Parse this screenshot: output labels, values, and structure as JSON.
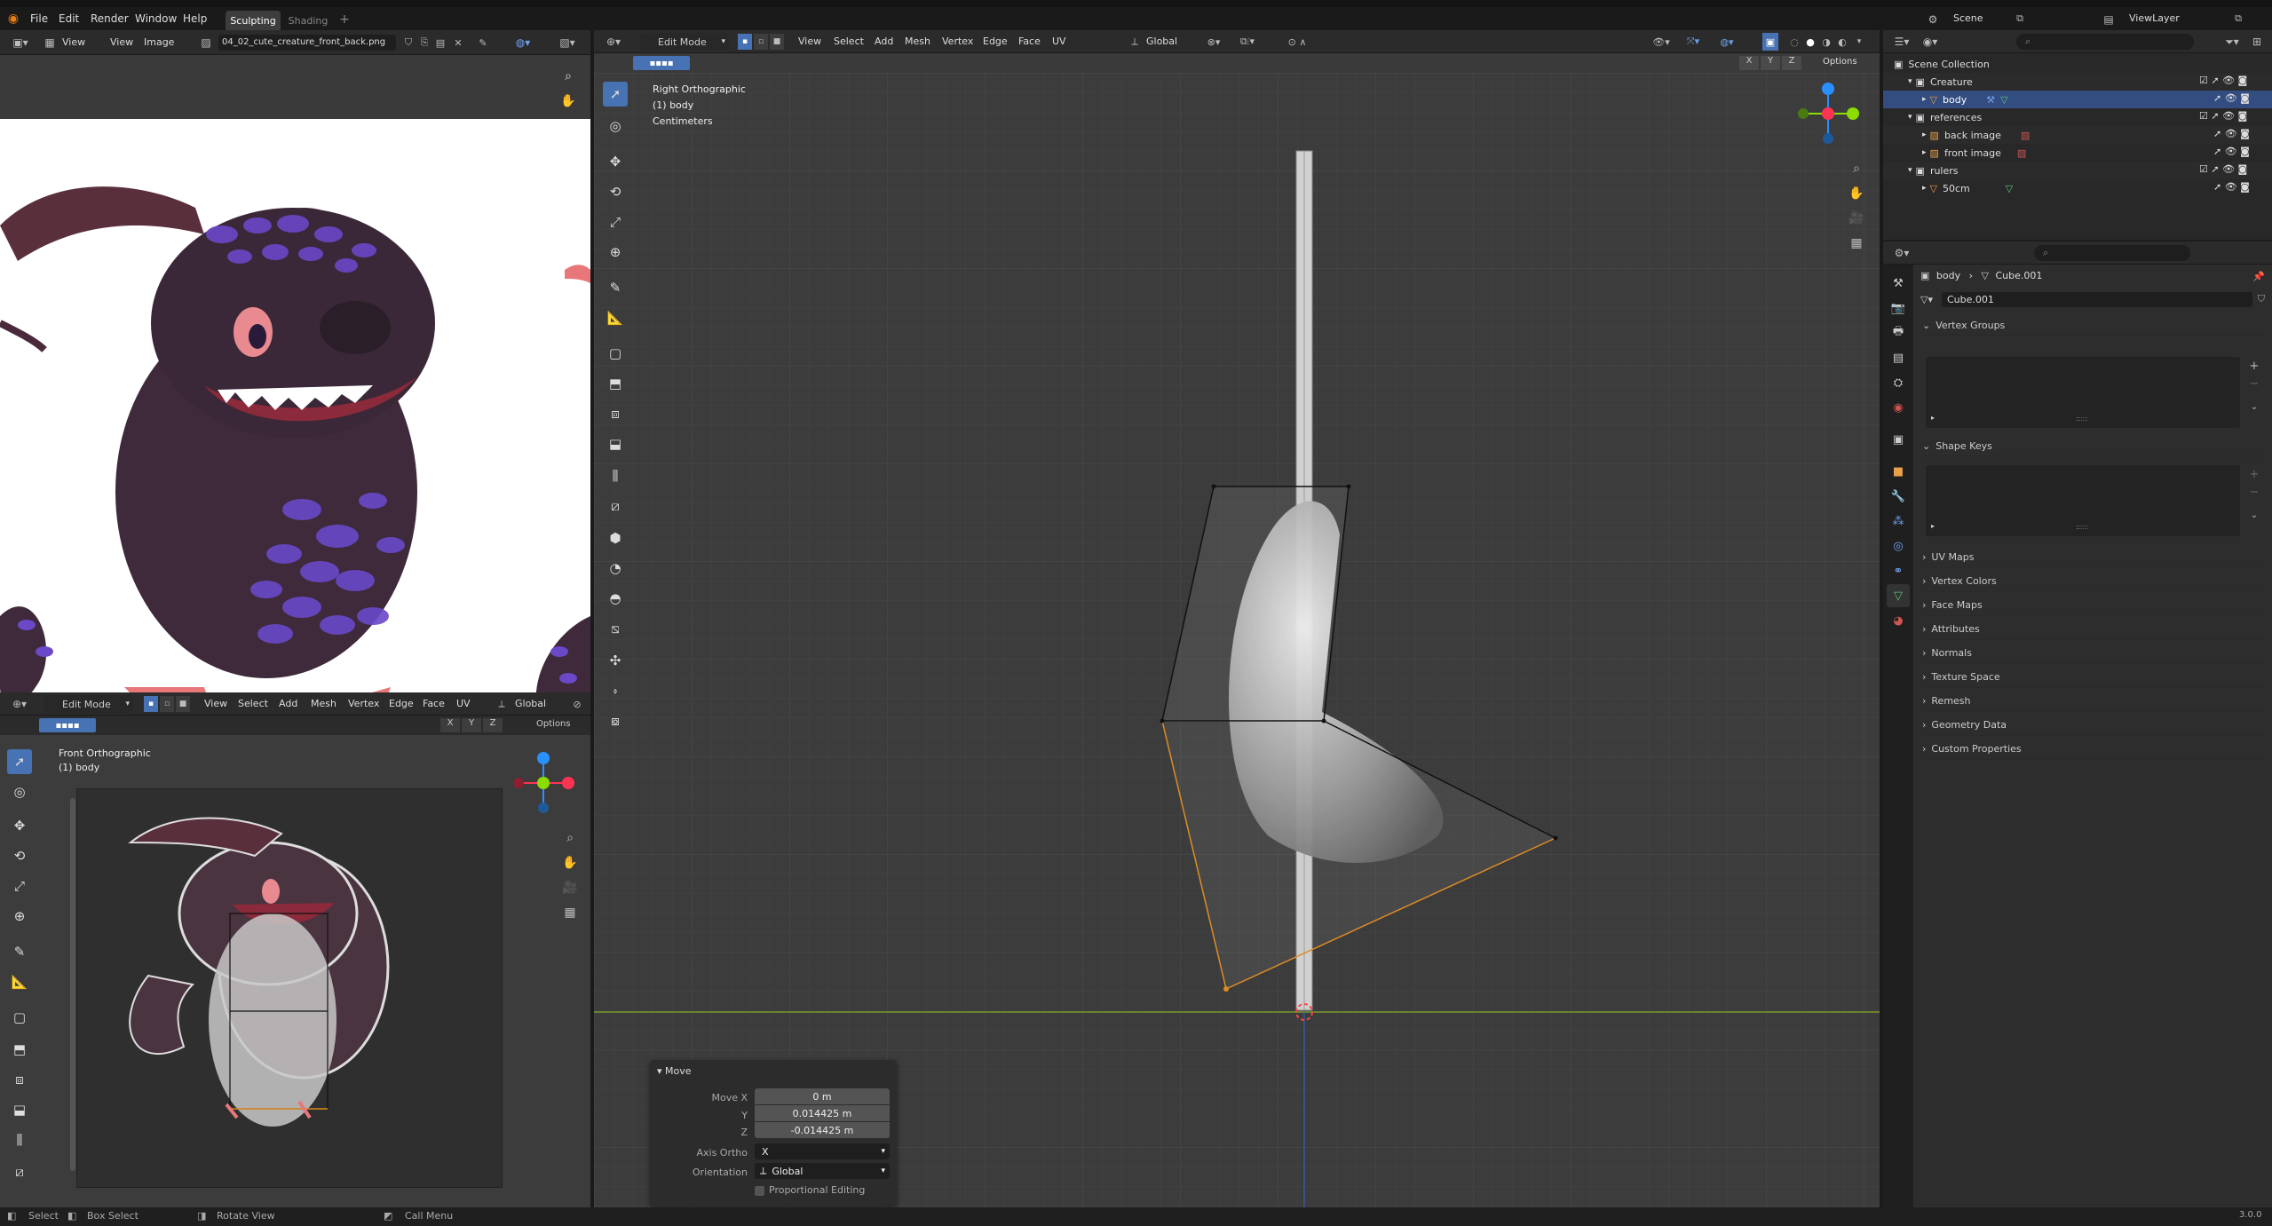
{
  "topbar": {
    "menus": [
      "File",
      "Edit",
      "Render",
      "Window",
      "Help"
    ],
    "workspaces": [
      "Sculpting",
      "Shading"
    ],
    "add_tab": "+",
    "scene_name": "Scene",
    "view_layer": "ViewLayer"
  },
  "image_editor": {
    "menus": [
      "View",
      "View",
      "Image"
    ],
    "image_name": "04_02_cute_creature_front_back.png"
  },
  "left_viewport": {
    "mode": "Edit Mode",
    "menus": [
      "View",
      "Select",
      "Add",
      "Mesh",
      "Vertex",
      "Edge",
      "Face",
      "UV"
    ],
    "orientation": "Global",
    "axes": [
      "X",
      "Y",
      "Z"
    ],
    "options": "Options",
    "view_name": "Front Orthographic",
    "object_name": "(1) body"
  },
  "main_viewport": {
    "mode": "Edit Mode",
    "menus": [
      "View",
      "Select",
      "Add",
      "Mesh",
      "Vertex",
      "Edge",
      "Face",
      "UV"
    ],
    "orientation": "Global",
    "axes": [
      "X",
      "Y",
      "Z"
    ],
    "options": "Options",
    "view_name": "Right Orthographic",
    "object_name": "(1) body",
    "units": "Centimeters"
  },
  "move_panel": {
    "title": "Move",
    "labels": [
      "Move X",
      "Y",
      "Z"
    ],
    "values": [
      "0 m",
      "0.014425 m",
      "-0.014425 m"
    ],
    "axis_ortho_label": "Axis Ortho",
    "axis_ortho_value": "X",
    "orientation_label": "Orientation",
    "orientation_value": "Global",
    "proportional": "Proportional Editing"
  },
  "outliner": {
    "root": "Scene Collection",
    "items": [
      {
        "label": "Creature",
        "depth": 1,
        "icon": "collection"
      },
      {
        "label": "body",
        "depth": 2,
        "icon": "mesh",
        "selected": true
      },
      {
        "label": "references",
        "depth": 1,
        "icon": "collection"
      },
      {
        "label": "back image",
        "depth": 2,
        "icon": "image"
      },
      {
        "label": "front image",
        "depth": 2,
        "icon": "image"
      },
      {
        "label": "rulers",
        "depth": 1,
        "icon": "collection"
      },
      {
        "label": "50cm",
        "depth": 2,
        "icon": "mesh"
      }
    ]
  },
  "properties": {
    "breadcrumb_object": "body",
    "breadcrumb_data": "Cube.001",
    "data_name": "Cube.001",
    "sections": [
      "Vertex Groups",
      "Shape Keys",
      "UV Maps",
      "Vertex Colors",
      "Face Maps",
      "Attributes",
      "Normals",
      "Texture Space",
      "Remesh",
      "Geometry Data",
      "Custom Properties"
    ]
  },
  "statusbar": {
    "items": [
      "Select",
      "Box Select",
      "Rotate View",
      "Call Menu"
    ],
    "version": "3.0.0"
  },
  "colors": {
    "accent": "#4772b3",
    "selected_row": "#334d80",
    "x_axis": "#ff3352",
    "y_axis": "#8bdc00",
    "z_axis": "#2890ff",
    "selected_edge": "#e08a1e"
  }
}
